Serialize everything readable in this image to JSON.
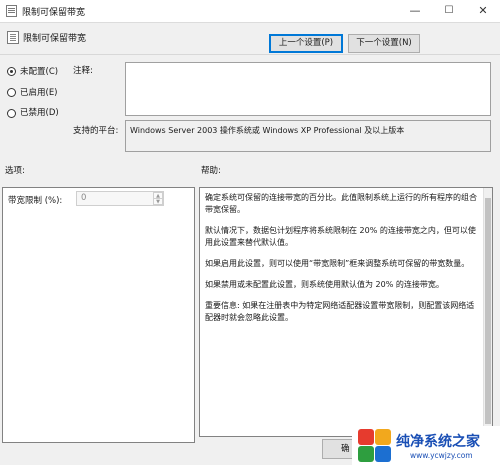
{
  "window": {
    "title": "限制可保留带宽",
    "controls": {
      "minimize": "—",
      "maximize": "☐",
      "close": "✕"
    }
  },
  "header": {
    "title": "限制可保留带宽",
    "prev_button": "上一个设置(P)",
    "next_button": "下一个设置(N)"
  },
  "state": {
    "options": [
      {
        "label": "未配置(C)",
        "selected": true
      },
      {
        "label": "已启用(E)",
        "selected": false
      },
      {
        "label": "已禁用(D)",
        "selected": false
      }
    ],
    "comment_label": "注释:",
    "comment_value": "",
    "platform_label": "支持的平台:",
    "platform_value": "Windows Server 2003 操作系统或 Windows XP Professional 及以上版本"
  },
  "options_panel": {
    "header": "选项:",
    "bandwidth_label": "带宽限制 (%):",
    "bandwidth_value": "0"
  },
  "help_panel": {
    "header": "帮助:",
    "paragraphs": [
      "确定系统可保留的连接带宽的百分比。此值限制系统上运行的所有程序的组合带宽保留。",
      "默认情况下，数据包计划程序将系统限制在 20% 的连接带宽之内，但可以使用此设置来替代默认值。",
      "如果启用此设置，则可以使用“带宽限制”框来调整系统可保留的带宽数量。",
      "如果禁用或未配置此设置，则系统使用默认值为 20% 的连接带宽。",
      "重要信息: 如果在注册表中为特定网络适配器设置带宽限制，则配置该网络适配器时就会忽略此设置。"
    ]
  },
  "footer": {
    "ok_button": "确"
  },
  "watermark": {
    "title": "纯净系统之家",
    "url": "www.ycwjzy.com",
    "colors": [
      "#e63b2e",
      "#f2a81d",
      "#2e9e3f",
      "#1c6fd1"
    ]
  }
}
